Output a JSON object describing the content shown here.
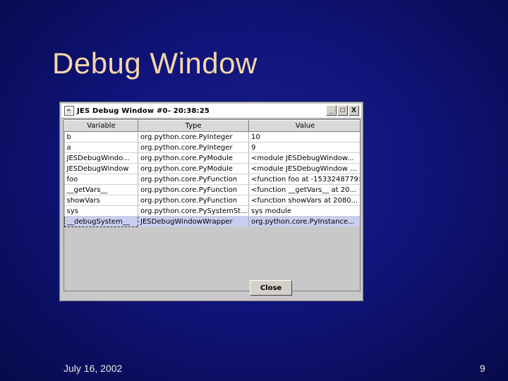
{
  "slide": {
    "title": "Debug Window",
    "footer_date": "July 16, 2002",
    "page_number": "9"
  },
  "window": {
    "title": "JES Debug Window #0- 20:38:25",
    "buttons": {
      "minimize": "_",
      "maximize": "□",
      "close": "X"
    },
    "columns": [
      "Variable",
      "Type",
      "Value"
    ],
    "rows": [
      [
        "b",
        "org.python.core.PyInteger",
        "10"
      ],
      [
        "a",
        "org.python.core.PyInteger",
        "9"
      ],
      [
        "JESDebugWindo...",
        "org.python.core.PyModule",
        "<module JESDebugWindow..."
      ],
      [
        "JESDebugWindow",
        "org.python.core.PyModule",
        "<module JESDebugWindow ..."
      ],
      [
        "foo",
        "org.python.core.PyFunction",
        "<function foo at -1533248779>"
      ],
      [
        "__getVars__",
        "org.python.core.PyFunction",
        "<function __getVars__ at 20..."
      ],
      [
        "showVars",
        "org.python.core.PyFunction",
        "<function showVars at 2080..."
      ],
      [
        "sys",
        "org.python.core.PySystemSt...",
        "sys module"
      ],
      [
        "__debugSystem__",
        "JESDebugWindowWrapper",
        "org.python.core.PyInstance..."
      ]
    ],
    "selected_row": 8,
    "close_label": "Close"
  }
}
